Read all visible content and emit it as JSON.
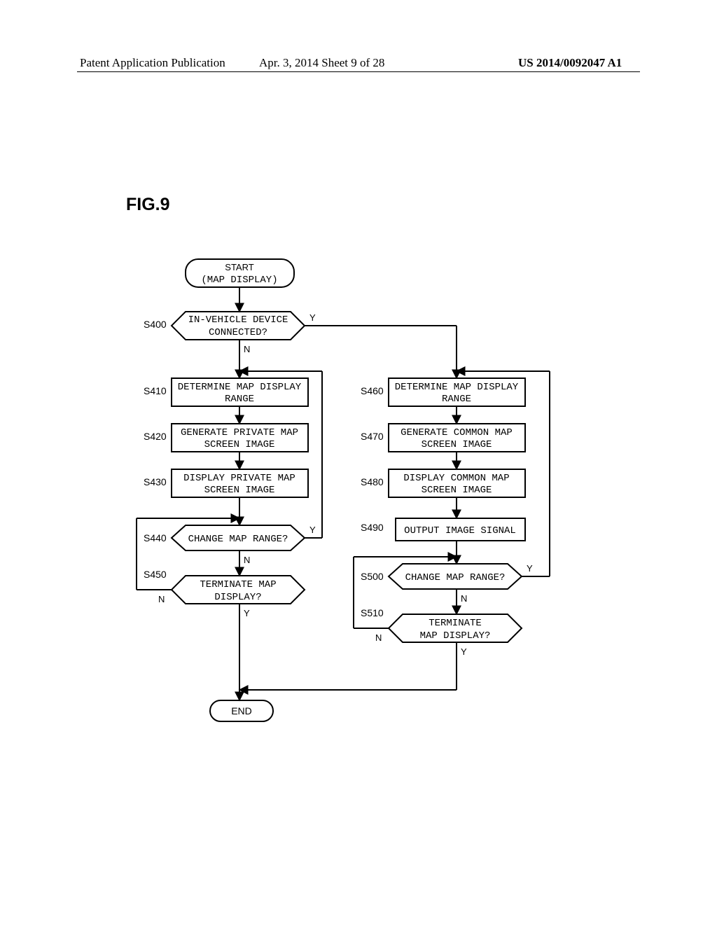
{
  "header": {
    "left": "Patent Application Publication",
    "center": "Apr. 3, 2014  Sheet 9 of 28",
    "right": "US 2014/0092047 A1"
  },
  "figure_label": "FIG.9",
  "chart_data": {
    "type": "flowchart",
    "title": "FIG.9",
    "start": {
      "text_line1": "START",
      "text_line2": "(MAP DISPLAY)"
    },
    "end": {
      "text": "END"
    },
    "left_branch_label": "N",
    "right_branch_label": "Y",
    "steps": {
      "S400": {
        "id": "S400",
        "kind": "decision",
        "text_line1": "IN-VEHICLE DEVICE",
        "text_line2": "CONNECTED?",
        "yes_to": "S460",
        "no_to": "S410",
        "yes_label": "Y",
        "no_label": "N"
      },
      "S410": {
        "id": "S410",
        "kind": "process",
        "text_line1": "DETERMINE MAP DISPLAY",
        "text_line2": "RANGE",
        "next": "S420"
      },
      "S420": {
        "id": "S420",
        "kind": "process",
        "text_line1": "GENERATE PRIVATE MAP",
        "text_line2": "SCREEN IMAGE",
        "next": "S430"
      },
      "S430": {
        "id": "S430",
        "kind": "process",
        "text_line1": "DISPLAY PRIVATE MAP",
        "text_line2": "SCREEN IMAGE",
        "next": "S440"
      },
      "S440": {
        "id": "S440",
        "kind": "decision",
        "text_line1": "CHANGE MAP RANGE?",
        "yes_to": "S410",
        "no_to": "S450",
        "yes_label": "Y",
        "no_label": "N"
      },
      "S450": {
        "id": "S450",
        "kind": "decision",
        "text_line1": "TERMINATE MAP",
        "text_line2": "DISPLAY?",
        "yes_to": "END",
        "no_to": "S440",
        "yes_label": "Y",
        "no_label": "N"
      },
      "S460": {
        "id": "S460",
        "kind": "process",
        "text_line1": "DETERMINE MAP DISPLAY",
        "text_line2": "RANGE",
        "next": "S470"
      },
      "S470": {
        "id": "S470",
        "kind": "process",
        "text_line1": "GENERATE COMMON MAP",
        "text_line2": "SCREEN IMAGE",
        "next": "S480"
      },
      "S480": {
        "id": "S480",
        "kind": "process",
        "text_line1": "DISPLAY COMMON MAP",
        "text_line2": "SCREEN IMAGE",
        "next": "S490"
      },
      "S490": {
        "id": "S490",
        "kind": "process",
        "text_line1": "OUTPUT IMAGE SIGNAL",
        "next": "S500"
      },
      "S500": {
        "id": "S500",
        "kind": "decision",
        "text_line1": "CHANGE MAP RANGE?",
        "yes_to": "S460",
        "no_to": "S510",
        "yes_label": "Y",
        "no_label": "N"
      },
      "S510": {
        "id": "S510",
        "kind": "decision",
        "text_line1": "TERMINATE",
        "text_line2": "MAP DISPLAY?",
        "yes_to": "END",
        "no_to": "S500",
        "yes_label": "Y",
        "no_label": "N"
      }
    }
  }
}
